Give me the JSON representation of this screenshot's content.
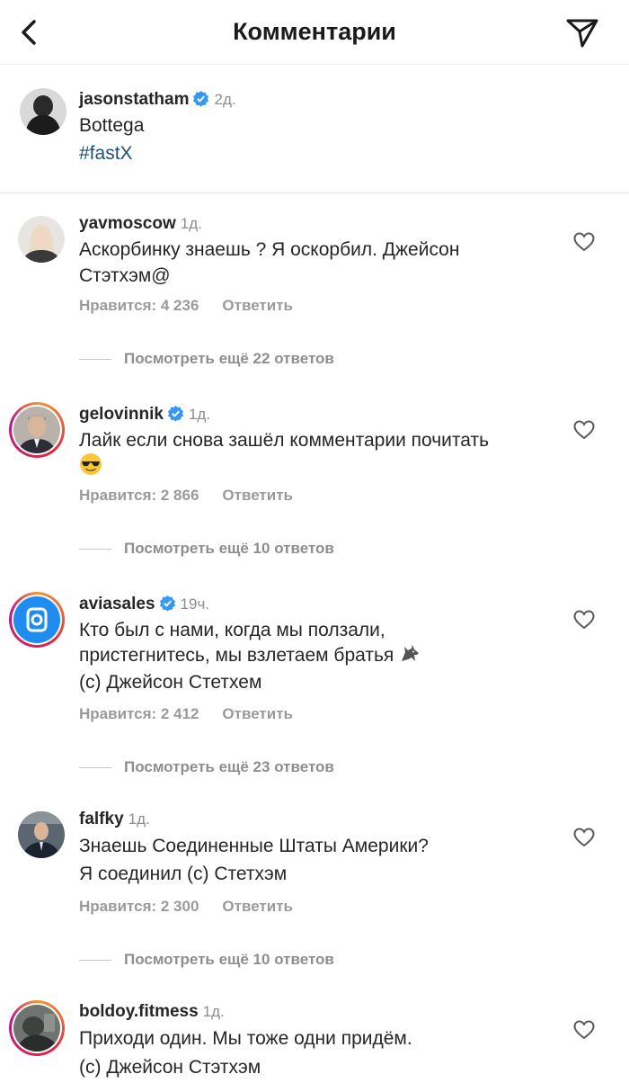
{
  "header": {
    "title": "Комментарии"
  },
  "post": {
    "username": "jasonstatham",
    "time": "2д.",
    "caption": "Bottega",
    "hashtag": "#fastX"
  },
  "comments": [
    {
      "username": "yavmoscow",
      "time": "1д.",
      "line1": "Аскорбинку знаешь ? Я оскорбил. Джейсон",
      "line2": "Стэтхэм@",
      "likes": "Нравится: 4 236",
      "reply": "Ответить",
      "more": "Посмотреть ещё 22 ответов"
    },
    {
      "username": "gelovinnik",
      "time": "1д.",
      "line1": "Лайк если снова зашёл комментарии почитать",
      "emoji": "smiling-face-with-sunglasses",
      "likes": "Нравится: 2 866",
      "reply": "Ответить",
      "more": "Посмотреть ещё 10 ответов"
    },
    {
      "username": "aviasales",
      "time": "19ч.",
      "line1": "Кто был с нами, когда мы ползали,",
      "line2": "пристегнитесь, мы взлетаем братья",
      "line3": "(с) Джейсон Стетхем",
      "emoji": "wolf",
      "likes": "Нравится: 2 412",
      "reply": "Ответить",
      "more": "Посмотреть ещё 23 ответов"
    },
    {
      "username": "falfky",
      "time": "1д.",
      "line1": "Знаешь Соединенные Штаты Америки?",
      "line2": "Я соединил (с) Стетхэм",
      "likes": "Нравится: 2 300",
      "reply": "Ответить",
      "more": "Посмотреть ещё 10 ответов"
    },
    {
      "username": "boldoy.fitmess",
      "time": "1д.",
      "line1": "Приходи один. Мы тоже одни придём.",
      "line2": "(с) Джейсон Стэтхэм"
    }
  ],
  "colors": {
    "text": "#262626",
    "muted": "#8e8e8e",
    "verified": "#3897f0",
    "hashtag": "#1f4f7a"
  },
  "icons": [
    "back-arrow-icon",
    "send-icon",
    "heart-icon",
    "verified-badge-icon"
  ]
}
